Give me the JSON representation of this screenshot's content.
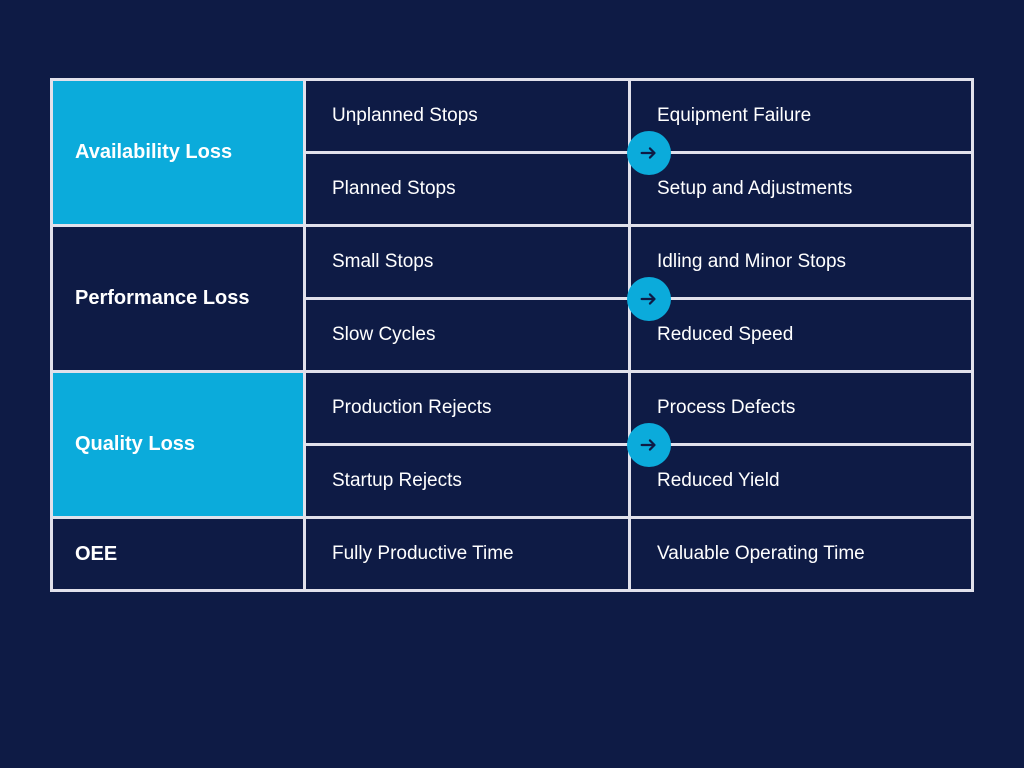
{
  "colors": {
    "bg": "#0e1b45",
    "accent": "#0babdb",
    "grid": "#e1e1eb",
    "text": "#ffffff"
  },
  "rows": [
    {
      "category": "Availability Loss",
      "style": "bright",
      "lines": [
        {
          "left": "Unplanned Stops",
          "right": "Equipment Failure"
        },
        {
          "left": "Planned Stops",
          "right": "Setup and Adjustments"
        }
      ],
      "arrow": true
    },
    {
      "category": "Performance Loss",
      "style": "dark",
      "lines": [
        {
          "left": "Small Stops",
          "right": "Idling and Minor Stops"
        },
        {
          "left": "Slow Cycles",
          "right": "Reduced Speed"
        }
      ],
      "arrow": true
    },
    {
      "category": "Quality Loss",
      "style": "bright",
      "lines": [
        {
          "left": "Production Rejects",
          "right": "Process Defects"
        },
        {
          "left": "Startup Rejects",
          "right": "Reduced Yield"
        }
      ],
      "arrow": true
    },
    {
      "category": "OEE",
      "style": "dark",
      "lines": [
        {
          "left": "Fully Productive Time",
          "right": "Valuable Operating Time"
        }
      ],
      "arrow": false
    }
  ]
}
